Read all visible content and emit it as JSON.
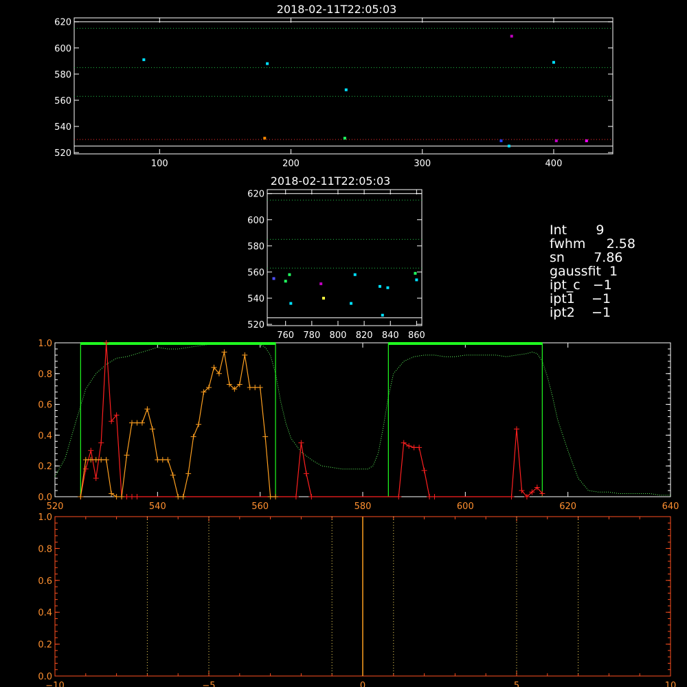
{
  "chart_data": [
    {
      "id": "scatter_top",
      "type": "scatter",
      "title": "2018-02-11T22:05:03",
      "xlim": [
        35,
        445
      ],
      "ylim": [
        519,
        623
      ],
      "xticks": [
        "100",
        "200",
        "300",
        "400"
      ],
      "xtick_values": [
        100,
        200,
        300,
        400
      ],
      "yticks": [
        "520",
        "540",
        "560",
        "580",
        "600",
        "620"
      ],
      "ytick_values": [
        520,
        540,
        560,
        580,
        600,
        620
      ],
      "hlines": [
        {
          "y": 615,
          "color": "#22c84a",
          "style": "dotted"
        },
        {
          "y": 585,
          "color": "#22c84a",
          "style": "dotted"
        },
        {
          "y": 563,
          "color": "#22c84a",
          "style": "dotted"
        },
        {
          "y": 530,
          "color": "#ff3030",
          "style": "dotted"
        },
        {
          "y": 525,
          "color": "#ffffff",
          "style": "solid"
        },
        {
          "y": 620,
          "color": "#ffffff",
          "style": "solid"
        }
      ],
      "points": [
        {
          "x": 88,
          "y": 591,
          "color": "#00e0ff"
        },
        {
          "x": 180,
          "y": 531,
          "color": "#ff8800"
        },
        {
          "x": 182,
          "y": 588,
          "color": "#00e0ff"
        },
        {
          "x": 242,
          "y": 568,
          "color": "#00e0ff"
        },
        {
          "x": 241,
          "y": 531,
          "color": "#20ff60"
        },
        {
          "x": 360,
          "y": 529,
          "color": "#2040ff"
        },
        {
          "x": 366,
          "y": 525,
          "color": "#00e0ff"
        },
        {
          "x": 368,
          "y": 609,
          "color": "#c000c0"
        },
        {
          "x": 400,
          "y": 589,
          "color": "#00e0ff"
        },
        {
          "x": 402,
          "y": 529,
          "color": "#c000c0"
        },
        {
          "x": 425,
          "y": 529,
          "color": "#ff00ff"
        }
      ]
    },
    {
      "id": "scatter_mid",
      "type": "scatter",
      "title": "2018-02-11T22:05:03",
      "xlim": [
        746,
        864
      ],
      "ylim": [
        519,
        623
      ],
      "xticks": [
        "760",
        "780",
        "800",
        "820",
        "840",
        "860"
      ],
      "xtick_values": [
        760,
        780,
        800,
        820,
        840,
        860
      ],
      "yticks": [
        "520",
        "540",
        "560",
        "580",
        "600",
        "620"
      ],
      "ytick_values": [
        520,
        540,
        560,
        580,
        600,
        620
      ],
      "hlines": [
        {
          "y": 615,
          "color": "#22c84a",
          "style": "dotted"
        },
        {
          "y": 585,
          "color": "#22c84a",
          "style": "dotted"
        },
        {
          "y": 563,
          "color": "#22c84a",
          "style": "dotted"
        },
        {
          "y": 525,
          "color": "#ffffff",
          "style": "solid"
        },
        {
          "y": 620,
          "color": "#ffffff",
          "style": "solid"
        }
      ],
      "points": [
        {
          "x": 751,
          "y": 555,
          "color": "#5050ff"
        },
        {
          "x": 760,
          "y": 553,
          "color": "#20ff60"
        },
        {
          "x": 763,
          "y": 558,
          "color": "#20ff60"
        },
        {
          "x": 764,
          "y": 536,
          "color": "#00e0ff"
        },
        {
          "x": 787,
          "y": 551,
          "color": "#c000c0"
        },
        {
          "x": 789,
          "y": 540,
          "color": "#ffff40"
        },
        {
          "x": 810,
          "y": 536,
          "color": "#00e0ff"
        },
        {
          "x": 813,
          "y": 558,
          "color": "#00e0ff"
        },
        {
          "x": 832,
          "y": 549,
          "color": "#00e0ff"
        },
        {
          "x": 834,
          "y": 527,
          "color": "#00e0ff"
        },
        {
          "x": 838,
          "y": 548,
          "color": "#00e0ff"
        },
        {
          "x": 859,
          "y": 559,
          "color": "#20ff60"
        },
        {
          "x": 860,
          "y": 554,
          "color": "#00e0ff"
        }
      ]
    },
    {
      "id": "spectrum",
      "type": "line",
      "xlim": [
        520,
        640
      ],
      "ylim": [
        0,
        1.0
      ],
      "xticks": [
        "520",
        "540",
        "560",
        "580",
        "600",
        "620",
        "640"
      ],
      "xtick_values": [
        520,
        540,
        560,
        580,
        600,
        620,
        640
      ],
      "yticks": [
        "0.0",
        "0.2",
        "0.4",
        "0.6",
        "0.8",
        "1.0"
      ],
      "ytick_values": [
        0,
        0.2,
        0.4,
        0.6,
        0.8,
        1.0
      ],
      "band_boxes": [
        {
          "x0": 525,
          "x1": 563
        },
        {
          "x0": 585,
          "x1": 615
        }
      ],
      "filter_curve": {
        "color": "#60ff60",
        "x": [
          520,
          522,
          524,
          526,
          528,
          530,
          532,
          534,
          536,
          538,
          540,
          542,
          544,
          546,
          548,
          550,
          552,
          554,
          556,
          558,
          560,
          561,
          562,
          563,
          564,
          565,
          566,
          568,
          570,
          572,
          574,
          576,
          578,
          580,
          581,
          582,
          583,
          584,
          585,
          586,
          588,
          590,
          592,
          594,
          596,
          598,
          600,
          602,
          604,
          606,
          608,
          610,
          612,
          613,
          614,
          615,
          616,
          617,
          618,
          620,
          622,
          624,
          626,
          628,
          630,
          632,
          634,
          636,
          638,
          640
        ],
        "y": [
          0.13,
          0.25,
          0.48,
          0.7,
          0.8,
          0.86,
          0.9,
          0.91,
          0.93,
          0.95,
          0.97,
          0.96,
          0.96,
          0.97,
          0.98,
          0.99,
          0.99,
          0.99,
          0.99,
          0.99,
          0.99,
          0.97,
          0.92,
          0.8,
          0.62,
          0.48,
          0.38,
          0.29,
          0.24,
          0.2,
          0.19,
          0.18,
          0.18,
          0.18,
          0.18,
          0.2,
          0.28,
          0.45,
          0.65,
          0.8,
          0.88,
          0.91,
          0.92,
          0.92,
          0.91,
          0.91,
          0.92,
          0.92,
          0.92,
          0.92,
          0.91,
          0.92,
          0.93,
          0.94,
          0.93,
          0.88,
          0.78,
          0.65,
          0.5,
          0.3,
          0.12,
          0.04,
          0.03,
          0.03,
          0.02,
          0.02,
          0.02,
          0.02,
          0.01,
          0.01
        ]
      },
      "series": [
        {
          "color": "#ff2020",
          "x": [
            525,
            526,
            527,
            528,
            529,
            530,
            531,
            532,
            533,
            534,
            535,
            536,
            567,
            568,
            569,
            570,
            587,
            588,
            589,
            590,
            591,
            592,
            593,
            594,
            609,
            610,
            611,
            612,
            613,
            614,
            615
          ],
          "y": [
            0.0,
            0.18,
            0.3,
            0.12,
            0.35,
            1.0,
            0.49,
            0.53,
            0.0,
            0.0,
            0.0,
            0.0,
            0.0,
            0.35,
            0.15,
            0.0,
            0.0,
            0.35,
            0.33,
            0.32,
            0.32,
            0.17,
            0.0,
            0.0,
            0.0,
            0.44,
            0.04,
            0.0,
            0.03,
            0.06,
            0.02
          ]
        },
        {
          "color": "#ffa020",
          "x": [
            525,
            526,
            527,
            528,
            529,
            530,
            531,
            532,
            533,
            534,
            535,
            536,
            537,
            538,
            539,
            540,
            541,
            542,
            543,
            544,
            545,
            546,
            547,
            548,
            549,
            550,
            551,
            552,
            553,
            554,
            555,
            556,
            557,
            558,
            559,
            560,
            561,
            562,
            563
          ],
          "y": [
            0.0,
            0.24,
            0.24,
            0.24,
            0.24,
            0.24,
            0.02,
            0.0,
            0.0,
            0.27,
            0.48,
            0.48,
            0.48,
            0.57,
            0.44,
            0.24,
            0.24,
            0.24,
            0.14,
            0.0,
            0.0,
            0.15,
            0.39,
            0.47,
            0.68,
            0.71,
            0.84,
            0.8,
            0.94,
            0.73,
            0.7,
            0.73,
            0.92,
            0.71,
            0.71,
            0.71,
            0.39,
            0.0,
            0.0
          ]
        }
      ]
    },
    {
      "id": "lag",
      "type": "line",
      "xlim": [
        -10,
        10
      ],
      "ylim": [
        0,
        1.0
      ],
      "xticks": [
        "−10",
        "−5",
        "0",
        "5",
        "10"
      ],
      "xtick_values": [
        -10,
        -5,
        0,
        5,
        10
      ],
      "yticks": [
        "0.0",
        "0.2",
        "0.4",
        "0.6",
        "0.8",
        "1.0"
      ],
      "ytick_values": [
        0,
        0.2,
        0.4,
        0.6,
        0.8,
        1.0
      ],
      "vlines": [
        {
          "x": -7,
          "color": "#ffe060",
          "style": "dotted"
        },
        {
          "x": -5,
          "color": "#ffe060",
          "style": "dotted"
        },
        {
          "x": -1,
          "color": "#ffe060",
          "style": "dotted"
        },
        {
          "x": 1,
          "color": "#ffe060",
          "style": "dotted"
        },
        {
          "x": 5,
          "color": "#ffe060",
          "style": "dotted"
        },
        {
          "x": 7,
          "color": "#ffe060",
          "style": "dotted"
        },
        {
          "x": 0,
          "color": "#ffa020",
          "style": "solid"
        }
      ]
    }
  ],
  "info_panel": {
    "lines": [
      "Int       9",
      "fwhm     2.58",
      "sn       7.86",
      "gaussfit  1",
      "ipt_c   −1",
      "ipt1    −1",
      "ipt2    −1"
    ]
  }
}
